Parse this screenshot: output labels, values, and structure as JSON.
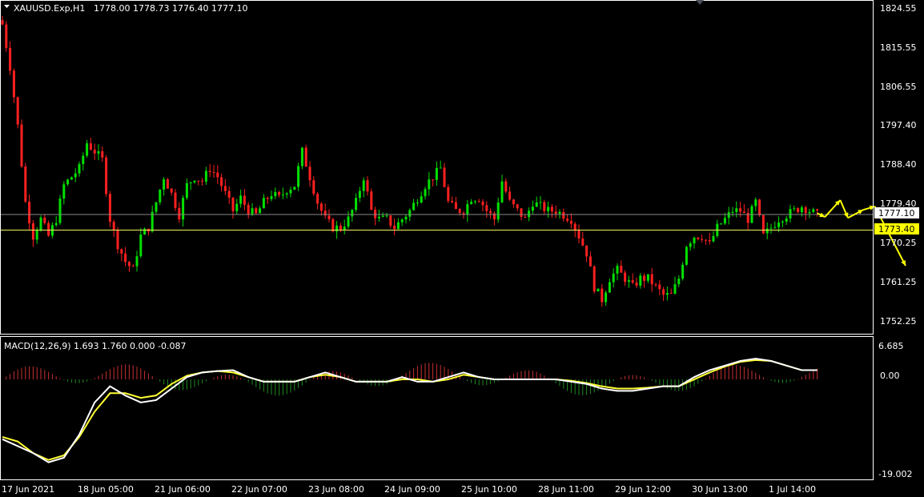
{
  "chart_data": {
    "type": "candlestick",
    "symbol_header": "XAUUSD.Exp,H1",
    "ohlc": {
      "open": "1778.00",
      "high": "1778.73",
      "low": "1776.40",
      "close": "1777.10"
    },
    "price_axis": {
      "ticks": [
        "1824.55",
        "1815.55",
        "1806.55",
        "1797.40",
        "1788.40",
        "1779.40",
        "1770.25",
        "1761.25",
        "1752.25"
      ],
      "range": [
        1749.5,
        1827.0
      ]
    },
    "current_price_label": "1777.10",
    "level_price_label": "1773.40",
    "time_axis": {
      "labels": [
        "17 Jun 2021",
        "18 Jun 05:00",
        "21 Jun 06:00",
        "22 Jun 07:00",
        "23 Jun 08:00",
        "24 Jun 09:00",
        "25 Jun 10:00",
        "28 Jun 11:00",
        "29 Jun 12:00",
        "30 Jun 13:00",
        "1 Jul 14:00"
      ]
    },
    "close_path": [
      [
        0,
        1822
      ],
      [
        2,
        1812
      ],
      [
        4,
        1798
      ],
      [
        6,
        1780
      ],
      [
        8,
        1772
      ],
      [
        10,
        1776
      ],
      [
        12,
        1772
      ],
      [
        14,
        1776
      ],
      [
        16,
        1784
      ],
      [
        18,
        1786
      ],
      [
        20,
        1788
      ],
      [
        22,
        1794
      ],
      [
        24,
        1792
      ],
      [
        26,
        1790
      ],
      [
        28,
        1776
      ],
      [
        30,
        1770
      ],
      [
        32,
        1766
      ],
      [
        34,
        1764
      ],
      [
        36,
        1772
      ],
      [
        38,
        1774
      ],
      [
        40,
        1780
      ],
      [
        42,
        1786
      ],
      [
        44,
        1782
      ],
      [
        46,
        1777
      ],
      [
        48,
        1784
      ],
      [
        50,
        1786
      ],
      [
        52,
        1785
      ],
      [
        54,
        1788
      ],
      [
        56,
        1786
      ],
      [
        58,
        1782
      ],
      [
        60,
        1778
      ],
      [
        62,
        1781
      ],
      [
        64,
        1778
      ],
      [
        66,
        1777
      ],
      [
        68,
        1780
      ],
      [
        70,
        1782
      ],
      [
        72,
        1781
      ],
      [
        74,
        1783
      ],
      [
        76,
        1784
      ],
      [
        78,
        1792
      ],
      [
        80,
        1786
      ],
      [
        82,
        1780
      ],
      [
        84,
        1776
      ],
      [
        86,
        1774
      ],
      [
        88,
        1774
      ],
      [
        90,
        1776
      ],
      [
        92,
        1780
      ],
      [
        94,
        1786
      ],
      [
        96,
        1778
      ],
      [
        98,
        1776
      ],
      [
        100,
        1776
      ],
      [
        102,
        1774
      ],
      [
        104,
        1776
      ],
      [
        106,
        1778
      ],
      [
        108,
        1781
      ],
      [
        110,
        1784
      ],
      [
        112,
        1786
      ],
      [
        114,
        1788
      ],
      [
        116,
        1780
      ],
      [
        118,
        1778
      ],
      [
        120,
        1778
      ],
      [
        122,
        1781
      ],
      [
        124,
        1781
      ],
      [
        126,
        1778
      ],
      [
        128,
        1776
      ],
      [
        130,
        1785
      ],
      [
        132,
        1780
      ],
      [
        134,
        1778
      ],
      [
        136,
        1776
      ],
      [
        138,
        1780
      ],
      [
        140,
        1779
      ],
      [
        142,
        1778
      ],
      [
        144,
        1778
      ],
      [
        146,
        1777
      ],
      [
        148,
        1776
      ],
      [
        150,
        1772
      ],
      [
        152,
        1768
      ],
      [
        154,
        1760
      ],
      [
        156,
        1757
      ],
      [
        158,
        1762
      ],
      [
        160,
        1764
      ],
      [
        162,
        1762
      ],
      [
        164,
        1760
      ],
      [
        166,
        1762
      ],
      [
        168,
        1762
      ],
      [
        170,
        1760
      ],
      [
        172,
        1758
      ],
      [
        174,
        1758
      ],
      [
        176,
        1762
      ],
      [
        178,
        1770
      ],
      [
        180,
        1772
      ],
      [
        182,
        1772
      ],
      [
        184,
        1770
      ],
      [
        186,
        1774
      ],
      [
        188,
        1776
      ],
      [
        190,
        1778
      ],
      [
        192,
        1778
      ],
      [
        194,
        1776
      ],
      [
        196,
        1780
      ],
      [
        198,
        1772
      ],
      [
        200,
        1774
      ],
      [
        202,
        1776
      ],
      [
        204,
        1777
      ],
      [
        206,
        1778
      ],
      [
        208,
        1779
      ],
      [
        210,
        1778
      ],
      [
        212,
        1777
      ]
    ],
    "forecast_path": [
      [
        212,
        1777.4
      ],
      [
        214,
        1776.5
      ],
      [
        218,
        1780.5
      ],
      [
        220,
        1776.3
      ],
      [
        224,
        1778.2
      ],
      [
        227,
        1779
      ],
      [
        235,
        1765
      ]
    ],
    "macd": {
      "label": "MACD(12,26,9) 1.693 1.760 0.000 -0.087",
      "range": [
        -20.5,
        8.0
      ],
      "ticks": [
        "6.685",
        "0.00",
        "-19.002"
      ],
      "macd_line": [
        [
          0,
          -13
        ],
        [
          4,
          -14.5
        ],
        [
          8,
          -16
        ],
        [
          12,
          -18
        ],
        [
          16,
          -17
        ],
        [
          20,
          -12
        ],
        [
          24,
          -5
        ],
        [
          28,
          -1.5
        ],
        [
          32,
          -3.5
        ],
        [
          36,
          -5
        ],
        [
          40,
          -4.5
        ],
        [
          44,
          -2
        ],
        [
          48,
          0.5
        ],
        [
          52,
          1.5
        ],
        [
          56,
          1.8
        ],
        [
          60,
          2
        ],
        [
          64,
          0.5
        ],
        [
          68,
          -0.5
        ],
        [
          72,
          -0.5
        ],
        [
          76,
          -0.5
        ],
        [
          80,
          0.5
        ],
        [
          84,
          1.5
        ],
        [
          88,
          0.5
        ],
        [
          92,
          -0.5
        ],
        [
          96,
          -0.5
        ],
        [
          100,
          -0.5
        ],
        [
          104,
          0.5
        ],
        [
          108,
          -0.5
        ],
        [
          112,
          -0.5
        ],
        [
          116,
          0.5
        ],
        [
          120,
          1.5
        ],
        [
          124,
          0.5
        ],
        [
          128,
          0
        ],
        [
          132,
          0
        ],
        [
          136,
          0
        ],
        [
          140,
          0
        ],
        [
          144,
          0
        ],
        [
          148,
          -0.5
        ],
        [
          152,
          -1
        ],
        [
          156,
          -2
        ],
        [
          160,
          -2.5
        ],
        [
          164,
          -2.5
        ],
        [
          168,
          -2
        ],
        [
          172,
          -1.5
        ],
        [
          176,
          -1.5
        ],
        [
          180,
          0.5
        ],
        [
          184,
          2
        ],
        [
          188,
          3
        ],
        [
          192,
          4
        ],
        [
          196,
          4.5
        ],
        [
          200,
          4
        ],
        [
          204,
          3
        ],
        [
          208,
          2
        ],
        [
          212,
          2
        ]
      ],
      "signal_line": [
        [
          0,
          -12.5
        ],
        [
          4,
          -13.5
        ],
        [
          8,
          -16
        ],
        [
          12,
          -17.5
        ],
        [
          16,
          -16.5
        ],
        [
          20,
          -12.5
        ],
        [
          24,
          -7
        ],
        [
          28,
          -3
        ],
        [
          32,
          -3
        ],
        [
          36,
          -4
        ],
        [
          40,
          -3.5
        ],
        [
          44,
          -1
        ],
        [
          48,
          0.8
        ],
        [
          52,
          1.5
        ],
        [
          56,
          1.8
        ],
        [
          60,
          1.5
        ],
        [
          64,
          0.5
        ],
        [
          68,
          -0.5
        ],
        [
          72,
          -0.5
        ],
        [
          76,
          -0.5
        ],
        [
          80,
          0.5
        ],
        [
          84,
          1
        ],
        [
          88,
          0.5
        ],
        [
          92,
          -0.5
        ],
        [
          96,
          -0.5
        ],
        [
          100,
          -0.5
        ],
        [
          104,
          0
        ],
        [
          108,
          0
        ],
        [
          112,
          -0.5
        ],
        [
          116,
          0
        ],
        [
          120,
          1
        ],
        [
          124,
          0.5
        ],
        [
          128,
          0
        ],
        [
          132,
          0
        ],
        [
          136,
          0
        ],
        [
          140,
          0
        ],
        [
          144,
          0
        ],
        [
          148,
          -0.3
        ],
        [
          152,
          -0.8
        ],
        [
          156,
          -1.5
        ],
        [
          160,
          -2
        ],
        [
          164,
          -2
        ],
        [
          168,
          -1.8
        ],
        [
          172,
          -1.5
        ],
        [
          176,
          -1.5
        ],
        [
          180,
          0
        ],
        [
          184,
          1.5
        ],
        [
          188,
          2.8
        ],
        [
          192,
          3.8
        ],
        [
          196,
          4.2
        ],
        [
          200,
          4
        ],
        [
          204,
          3
        ],
        [
          208,
          2
        ],
        [
          212,
          2
        ]
      ]
    }
  },
  "colors": {
    "background": "#000000",
    "grid_frame": "#ffffff",
    "bull": "#00e000",
    "bear": "#ff2020",
    "macd_line": "#ffffff",
    "signal_line": "#ffff33",
    "hist_up": "#c83030",
    "hist_down": "#1f8a1f",
    "level_line": "#f2f25a",
    "current_line": "#888888",
    "forecast_arrow": "#ffff00",
    "level_badge": "#ffff00"
  }
}
